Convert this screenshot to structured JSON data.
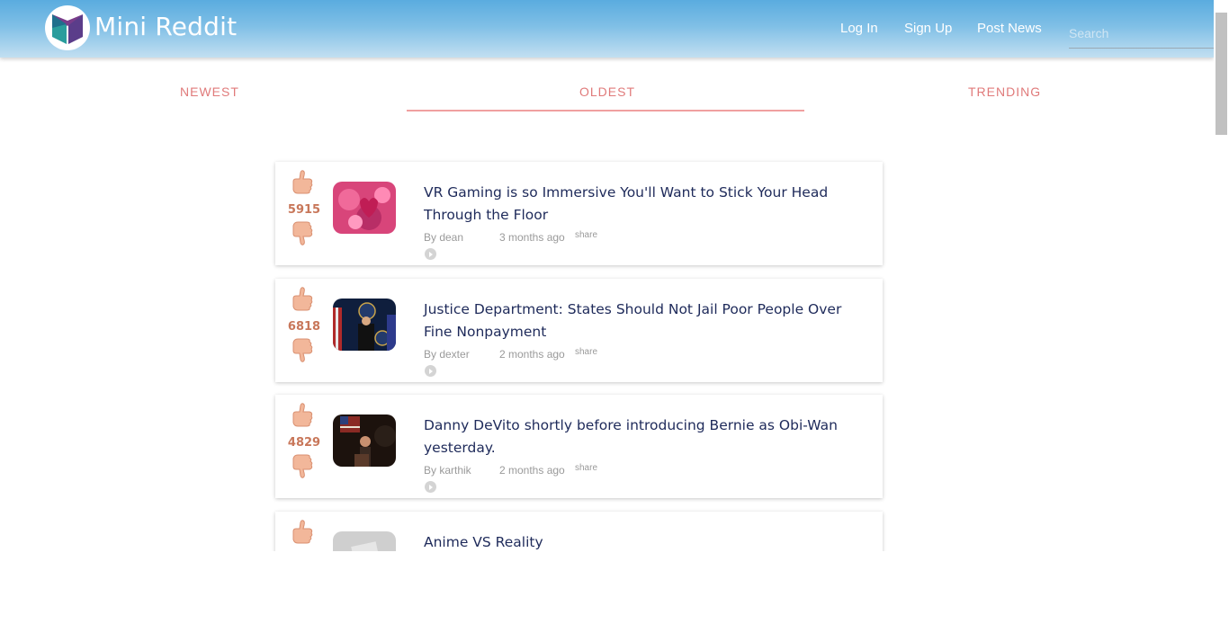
{
  "header": {
    "brand": "Mini Reddit",
    "nav": {
      "login": "Log In",
      "signup": "Sign Up",
      "post_news": "Post News"
    },
    "search_placeholder": "Search"
  },
  "tabs": {
    "newest": "NEWEST",
    "oldest": "OLDEST",
    "trending": "TRENDING",
    "active": "oldest"
  },
  "colors": {
    "header_top": "#5aacdf",
    "tab_text": "#e07a7a",
    "score": "#c8775a",
    "title": "#1e2a5a"
  },
  "posts": [
    {
      "score": "5915",
      "title": "VR Gaming is so Immersive You'll Want to Stick Your Head Through the Floor",
      "author": "By dean",
      "time": "3 months ago",
      "share": "share"
    },
    {
      "score": "6818",
      "title": "Justice Department: States Should Not Jail Poor People Over Fine Nonpayment",
      "author": "By dexter",
      "time": "2 months ago",
      "share": "share"
    },
    {
      "score": "4829",
      "title": "Danny DeVito shortly before introducing Bernie as Obi-Wan yesterday.",
      "author": "By karthik",
      "time": "2 months ago",
      "share": "share"
    },
    {
      "score": "",
      "title": "Anime VS Reality",
      "author": "",
      "time": "",
      "share": ""
    }
  ],
  "icons": {
    "upvote": "thumbs-up-icon",
    "downvote": "thumbs-down-icon",
    "play": "play-circle-icon"
  }
}
